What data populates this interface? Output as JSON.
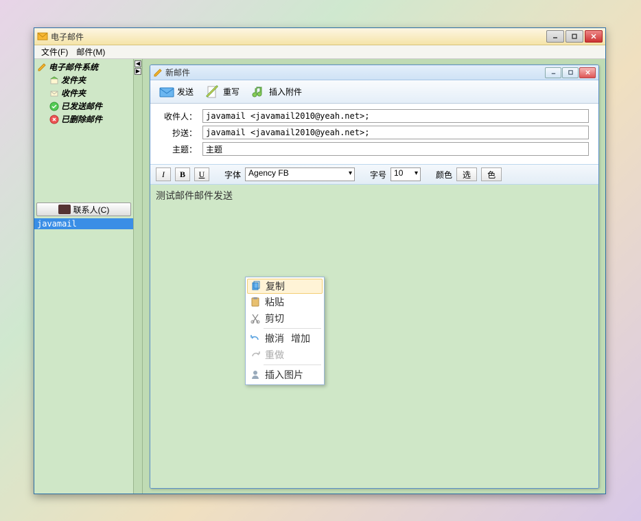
{
  "main_window": {
    "title": "电子邮件"
  },
  "menubar": [
    "文件(F)",
    "邮件(M)"
  ],
  "tree": {
    "root": "电子邮件系统",
    "items": [
      "发件夹",
      "收件夹",
      "已发送邮件",
      "已删除邮件"
    ]
  },
  "contacts": {
    "header": "联系人(C)",
    "list": [
      "javamail"
    ]
  },
  "compose": {
    "title": "新邮件",
    "toolbar": {
      "send": "发送",
      "rewrite": "重写",
      "attach": "插入附件"
    },
    "fields": {
      "to_label": "收件人：",
      "to_value": "javamail <javamail2010@yeah.net>;",
      "cc_label": "抄送：",
      "cc_value": "javamail <javamail2010@yeah.net>;",
      "subject_label": "主题：",
      "subject_value": "主题"
    },
    "format": {
      "font_label": "字体",
      "font_value": "Agency FB",
      "size_label": "字号",
      "size_value": "10",
      "color_label": "颜色",
      "btn_select": "选",
      "btn_color": "色"
    },
    "body": "测试邮件邮件发送"
  },
  "context_menu": {
    "items": [
      {
        "label": "复制",
        "icon": "copy",
        "highlight": true
      },
      {
        "label": "粘贴",
        "icon": "paste"
      },
      {
        "label": "剪切",
        "icon": "cut"
      }
    ],
    "items2": [
      {
        "label": "撤消",
        "icon": "undo",
        "submenu": "增加"
      },
      {
        "label": "重做",
        "icon": "redo",
        "disabled": true
      }
    ],
    "items3": [
      {
        "label": "插入图片",
        "icon": "image"
      }
    ]
  }
}
